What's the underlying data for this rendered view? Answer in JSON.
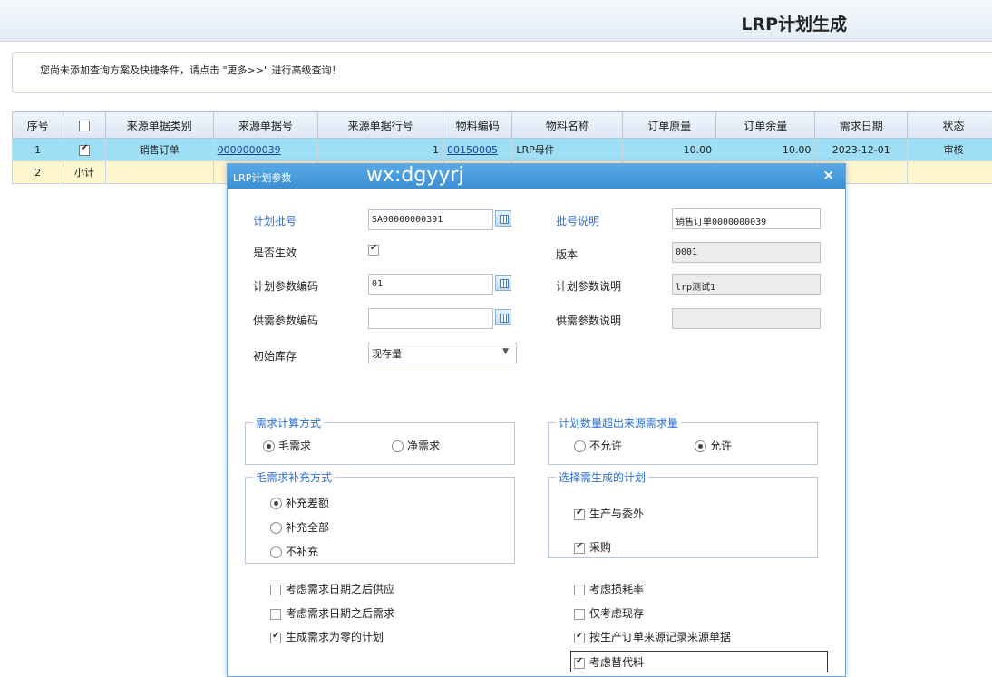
{
  "page": {
    "title": "LRP计划生成"
  },
  "hint": {
    "text": "您尚未添加查询方案及快捷条件，请点击 \"更多>>\" 进行高级查询！"
  },
  "grid": {
    "headers": [
      "序号",
      "",
      "来源单据类别",
      "来源单据号",
      "来源单据行号",
      "物料编码",
      "物料名称",
      "订单原量",
      "订单余量",
      "需求日期",
      "状态"
    ],
    "rows": [
      {
        "seq": "1",
        "checked": true,
        "src_type": "销售订单",
        "src_no": "0000000039",
        "line_no": "1",
        "item_code": "00150005",
        "item_name": "LRP母件",
        "orig_qty": "10.00",
        "remain_qty": "10.00",
        "date": "2023-12-01",
        "status": "审核"
      }
    ],
    "subtotal": {
      "seq": "2",
      "label": "小计"
    }
  },
  "dialog": {
    "title": "LRP计划参数",
    "watermark": "wx:dgyyrj",
    "close": "×",
    "fields": {
      "batch_no_label": "计划批号",
      "batch_no_value": "SA00000000391",
      "batch_desc_label": "批号说明",
      "batch_desc_value": "销售订单0000000039",
      "effective_label": "是否生效",
      "effective_checked": true,
      "version_label": "版本",
      "version_value": "0001",
      "param_code_label": "计划参数编码",
      "param_code_value": "01",
      "param_desc_label": "计划参数说明",
      "param_desc_value": "lrp测试1",
      "supply_code_label": "供需参数编码",
      "supply_code_value": "",
      "supply_desc_label": "供需参数说明",
      "supply_desc_value": "",
      "init_stock_label": "初始库存",
      "init_stock_value": "现存量"
    },
    "demand_calc": {
      "legend": "需求计算方式",
      "opt1": "毛需求",
      "opt2": "净需求",
      "selected": "毛需求"
    },
    "exceed": {
      "legend": "计划数量超出来源需求量",
      "opt1": "不允许",
      "opt2": "允许",
      "selected": "允许"
    },
    "gross_fill": {
      "legend": "毛需求补充方式",
      "opt1": "补充差额",
      "opt2": "补充全部",
      "opt3": "不补充",
      "selected": "补充差额"
    },
    "plans": {
      "legend": "选择需生成的计划",
      "opt1": "生产与委外",
      "opt2": "采购",
      "opt1_checked": true,
      "opt2_checked": true
    },
    "options_left": [
      {
        "label": "考虑需求日期之后供应",
        "checked": false
      },
      {
        "label": "考虑需求日期之后需求",
        "checked": false
      },
      {
        "label": "生成需求为零的计划",
        "checked": true
      }
    ],
    "options_right": [
      {
        "label": "考虑损耗率",
        "checked": false
      },
      {
        "label": "仅考虑现存",
        "checked": false
      },
      {
        "label": "按生产订单来源记录来源单据",
        "checked": true
      },
      {
        "label": "考虑替代料",
        "checked": true
      }
    ]
  }
}
